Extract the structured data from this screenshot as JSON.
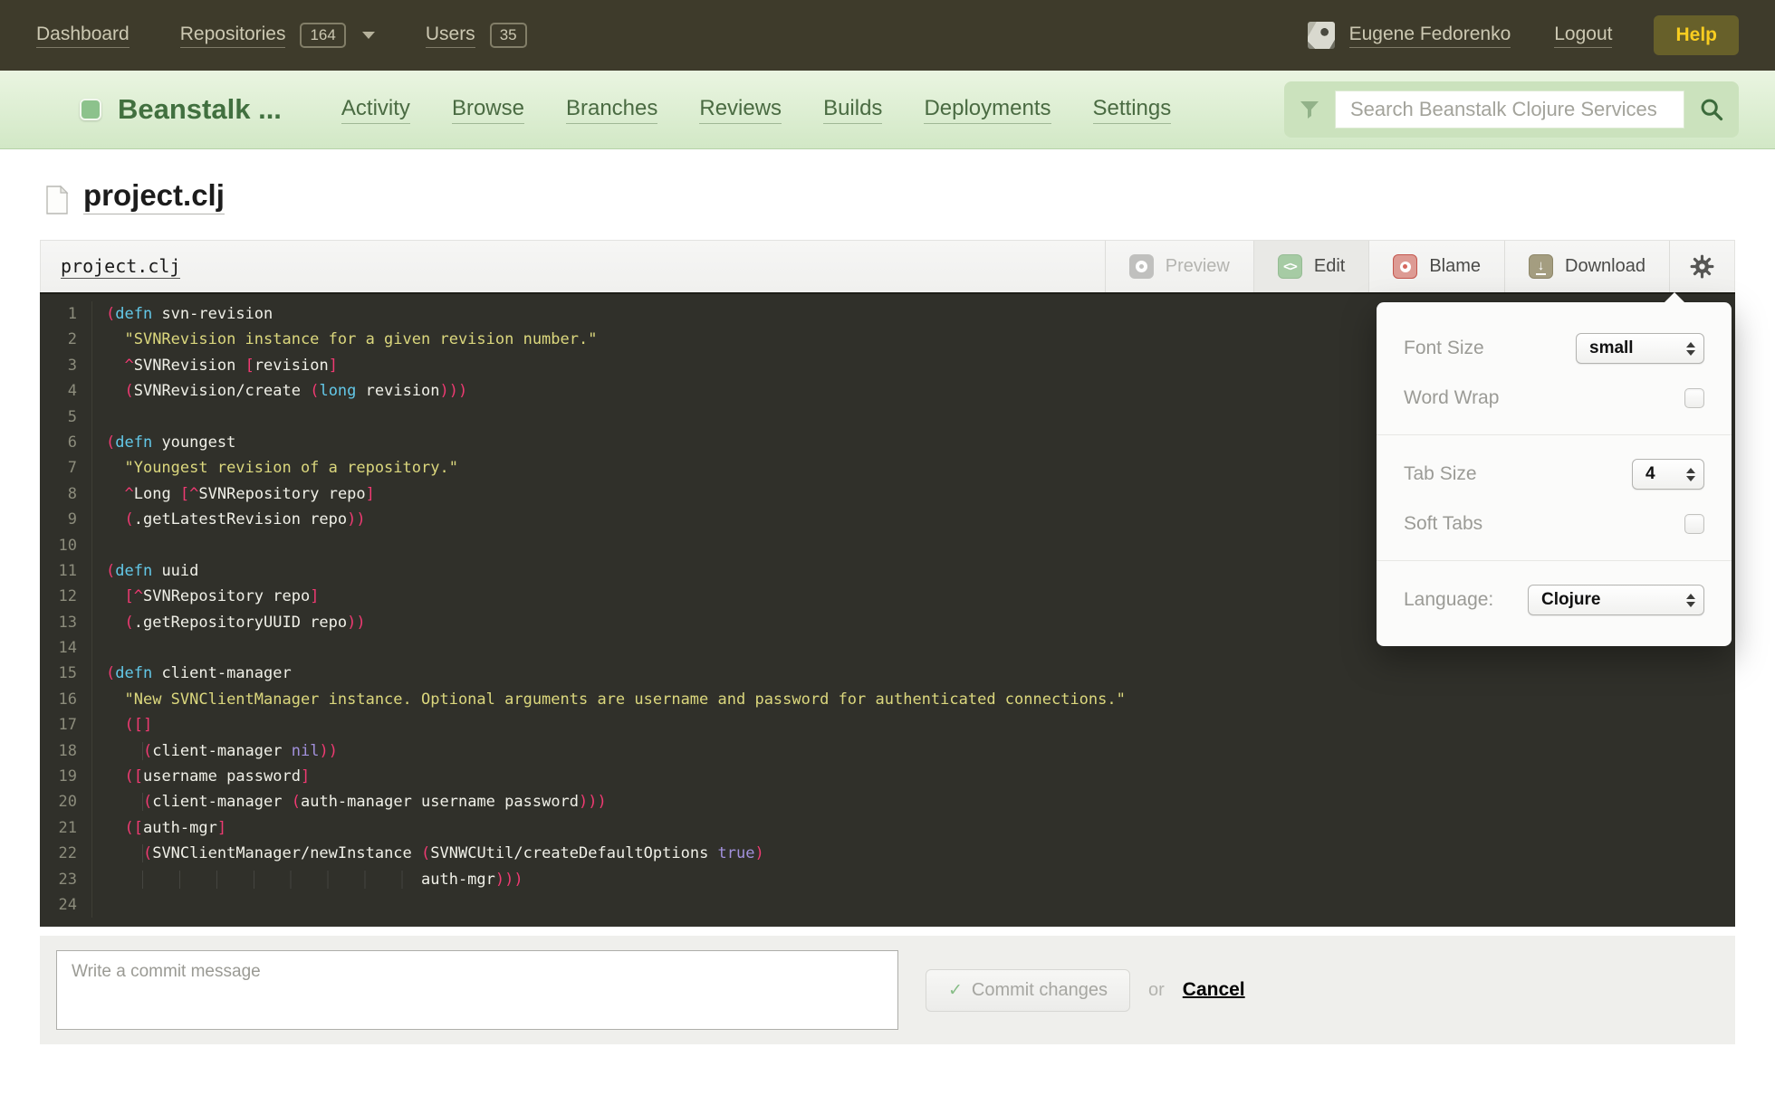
{
  "topbar": {
    "dashboard": "Dashboard",
    "repositories": "Repositories",
    "repositories_count": "164",
    "users": "Users",
    "users_count": "35",
    "user_name": "Eugene Fedorenko",
    "logout": "Logout",
    "help": "Help"
  },
  "header": {
    "logo_text": "Beanstalk ...",
    "nav": [
      "Activity",
      "Browse",
      "Branches",
      "Reviews",
      "Builds",
      "Deployments",
      "Settings"
    ],
    "search_placeholder": "Search Beanstalk Clojure Services"
  },
  "page": {
    "title": "project.clj"
  },
  "toolbar": {
    "filename": "project.clj",
    "preview": "Preview",
    "edit": "Edit",
    "blame": "Blame",
    "download": "Download"
  },
  "settings_panel": {
    "font_size_label": "Font Size",
    "font_size_value": "small",
    "word_wrap_label": "Word Wrap",
    "tab_size_label": "Tab Size",
    "tab_size_value": "4",
    "soft_tabs_label": "Soft Tabs",
    "language_label": "Language:",
    "language_value": "Clojure"
  },
  "commit": {
    "placeholder": "Write a commit message",
    "commit_label": "Commit changes",
    "or_label": "or",
    "cancel_label": "Cancel"
  },
  "colors": {
    "topbar_bg": "#3e3b2b",
    "help_yellow": "#f8cd20",
    "green_accent": "#8cc28c",
    "code_bg": "#30302a",
    "paren_pink": "#ef3a72",
    "keyword_cyan": "#63c8e8",
    "string_yellow": "#dbd77d",
    "literal_purple": "#a291dc"
  },
  "code": {
    "lines": [
      [
        [
          "(",
          "p"
        ],
        [
          "defn",
          "k"
        ],
        [
          " svn-revision",
          "w"
        ]
      ],
      [
        [
          "  ",
          "w"
        ],
        [
          "\"SVNRevision instance for a given revision number.\"",
          "s"
        ]
      ],
      [
        [
          "  ",
          "w"
        ],
        [
          "^",
          "p"
        ],
        [
          "SVNRevision ",
          "w"
        ],
        [
          "[",
          "p"
        ],
        [
          "revision",
          "w"
        ],
        [
          "]",
          "p"
        ]
      ],
      [
        [
          "  ",
          "w"
        ],
        [
          "(",
          "p"
        ],
        [
          "SVNRevision/create ",
          "w"
        ],
        [
          "(",
          "p"
        ],
        [
          "long",
          "k"
        ],
        [
          " revision",
          "w"
        ],
        [
          ")))",
          "p"
        ]
      ],
      [],
      [
        [
          "(",
          "p"
        ],
        [
          "defn",
          "k"
        ],
        [
          " youngest",
          "w"
        ]
      ],
      [
        [
          "  ",
          "w"
        ],
        [
          "\"Youngest revision of a repository.\"",
          "s"
        ]
      ],
      [
        [
          "  ",
          "w"
        ],
        [
          "^",
          "p"
        ],
        [
          "Long ",
          "w"
        ],
        [
          "[",
          "p"
        ],
        [
          "^",
          "p"
        ],
        [
          "SVNRepository repo",
          "w"
        ],
        [
          "]",
          "p"
        ]
      ],
      [
        [
          "  ",
          "w"
        ],
        [
          "(",
          "p"
        ],
        [
          ".getLatestRevision repo",
          "w"
        ],
        [
          "))",
          "p"
        ]
      ],
      [],
      [
        [
          "(",
          "p"
        ],
        [
          "defn",
          "k"
        ],
        [
          " uuid",
          "w"
        ]
      ],
      [
        [
          "  ",
          "w"
        ],
        [
          "[",
          "p"
        ],
        [
          "^",
          "p"
        ],
        [
          "SVNRepository repo",
          "w"
        ],
        [
          "]",
          "p"
        ]
      ],
      [
        [
          "  ",
          "w"
        ],
        [
          "(",
          "p"
        ],
        [
          ".getRepositoryUUID repo",
          "w"
        ],
        [
          "))",
          "p"
        ]
      ],
      [],
      [
        [
          "(",
          "p"
        ],
        [
          "defn",
          "k"
        ],
        [
          " client-manager",
          "w"
        ]
      ],
      [
        [
          "  ",
          "w"
        ],
        [
          "\"New SVNClientManager instance. Optional arguments are username and password for authenticated connections.\"",
          "s"
        ]
      ],
      [
        [
          "  ",
          "w"
        ],
        [
          "([]",
          "p"
        ]
      ],
      [
        [
          "    ",
          "i"
        ],
        [
          "(",
          "p"
        ],
        [
          "client-manager ",
          "w"
        ],
        [
          "nil",
          "v"
        ],
        [
          "))",
          "p"
        ]
      ],
      [
        [
          "  ",
          "w"
        ],
        [
          "([",
          "p"
        ],
        [
          "username password",
          "w"
        ],
        [
          "]",
          "p"
        ]
      ],
      [
        [
          "    ",
          "i"
        ],
        [
          "(",
          "p"
        ],
        [
          "client-manager ",
          "w"
        ],
        [
          "(",
          "p"
        ],
        [
          "auth-manager username password",
          "w"
        ],
        [
          ")))",
          "p"
        ]
      ],
      [
        [
          "  ",
          "w"
        ],
        [
          "([",
          "p"
        ],
        [
          "auth-mgr",
          "w"
        ],
        [
          "]",
          "p"
        ]
      ],
      [
        [
          "    ",
          "i"
        ],
        [
          "(",
          "p"
        ],
        [
          "SVNClientManager/newInstance ",
          "w"
        ],
        [
          "(",
          "p"
        ],
        [
          "SVNWCUtil/createDefaultOptions ",
          "w"
        ],
        [
          "true",
          "v"
        ],
        [
          ")",
          "p"
        ]
      ],
      [
        [
          "                                  ",
          "i"
        ],
        [
          "auth-mgr",
          "w"
        ],
        [
          ")))",
          "p"
        ]
      ],
      []
    ]
  }
}
